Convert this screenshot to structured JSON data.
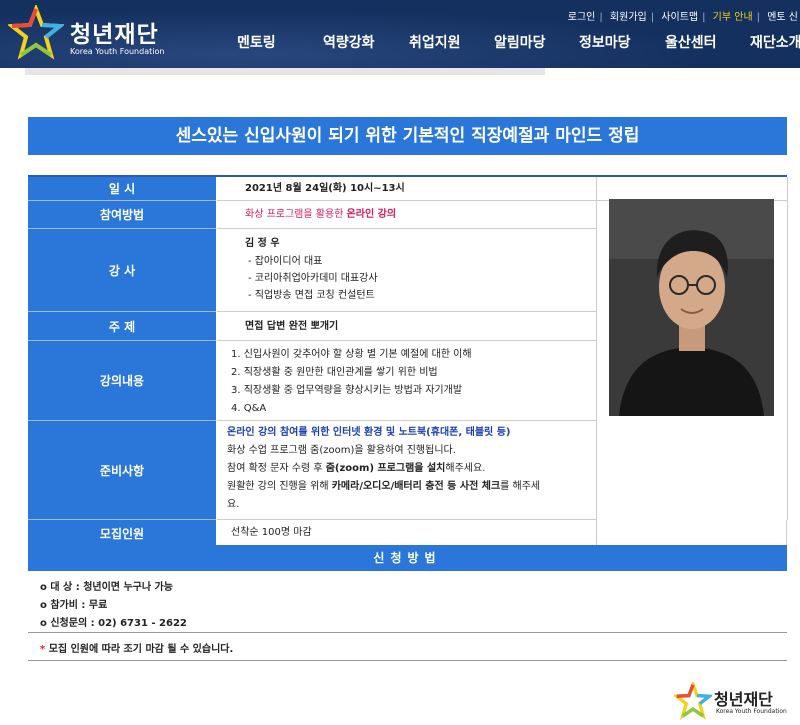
{
  "header": {
    "logo_text": "청년재단",
    "logo_sub": "Korea Youth Foundation",
    "util_links": [
      "로그인",
      "회원가입",
      "사이트맵",
      "기부 안내",
      "멘토 신"
    ],
    "nav": [
      "멘토링",
      "역량강화",
      "취업지원",
      "알림마당",
      "정보마당",
      "울산센터",
      "재단소개"
    ]
  },
  "title": "센스있는 신입사원이 되기 위한 기본적인 직장예절과 마인드 정립",
  "rows": {
    "date_label": "일 시",
    "date_value": "2021년 8월 24일(화) 10시~13시",
    "method_label": "참여방법",
    "method_prefix": "화상 프로그램을 활용한 ",
    "method_bold": "온라인 강의",
    "lecturer_label": "강 사",
    "lecturer_name": "김 정 우",
    "lecturer_lines": [
      "- 잡아이디어 대표",
      "- 코리아취업아카데미 대표강사",
      "- 직업방송 면접 코칭 컨설턴트"
    ],
    "topic_label": "주 제",
    "topic_value": "면접 답변 완전 뽀개기",
    "content_label": "강의내용",
    "content_lines": [
      "1. 신입사원이 갖추어야 할 상황 별 기본 예절에 대한 이해",
      "2. 직장생활 중 원만한 대인관계를 쌓기 위한 비법",
      "3. 직장생활 중 업무역량을 향상시키는 방법과 자기개발",
      "4.  Q&A"
    ],
    "prep_label": "준비사항",
    "prep_highlight": "온라인 강의 참여를 위한 인터넷 환경 및 노트북(휴대폰, 태블릿 등)",
    "prep_line2": "화상 수업 프로그램 줌(zoom)을 활용하여 진행됩니다.",
    "prep_line3_a": "참여 확정 문자 수령 후 ",
    "prep_line3_b": "줌(zoom) 프로그램을 설치",
    "prep_line3_c": "해주세요.",
    "prep_line4_a": "원활한 강의 진행을 위해 ",
    "prep_line4_b": "카메라/오디오/배터리 충전 등 사전 체크",
    "prep_line4_c": "를 해주세",
    "prep_line5": "요.",
    "recruit_label": "모집인원",
    "recruit_value": "선착순 100명 마감"
  },
  "apply": {
    "bar": "신청방법",
    "target": "o 대 상 : 청년이면 누구나 가능",
    "fee": "o 참가비 : 무료",
    "contact": "o 신청문의 : 02) 6731 - 2622",
    "notice_star": "*",
    "notice": " 모집 인원에 따라 조기 마감 될 수 있습니다."
  },
  "footer": {
    "logo_text": "청년재단",
    "logo_sub": "Korea Youth Foundation"
  },
  "colors": {
    "header_bg": "#13305f",
    "accent_blue": "#2a77d9",
    "highlight_pink": "#d81b60",
    "highlight_blue": "#1a3fb0"
  }
}
